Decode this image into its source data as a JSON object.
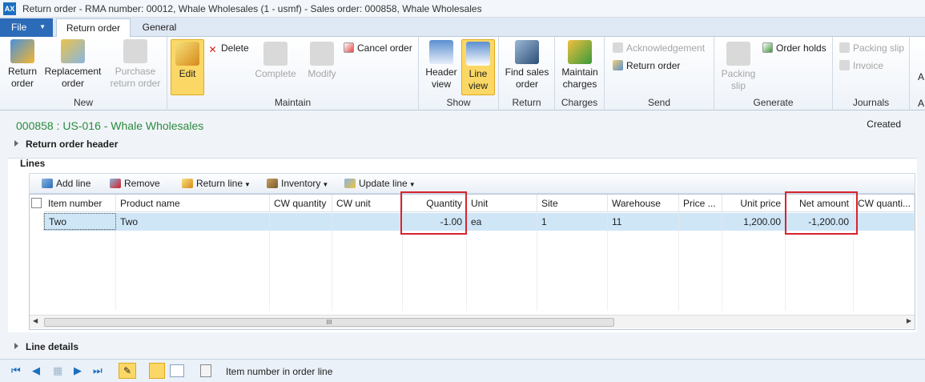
{
  "window": {
    "title": "Return order  -  RMA number: 00012,  Whale Wholesales (1 - usmf) - Sales order: 000858, Whale Wholesales",
    "icon": "app-icon"
  },
  "tabs": {
    "file": "File",
    "return_order": "Return order",
    "general": "General"
  },
  "ribbon": {
    "new": {
      "label": "New",
      "return_order": "Return order",
      "replacement_order": "Replacement order",
      "purchase_return_order": "Purchase return order"
    },
    "maintain": {
      "label": "Maintain",
      "edit": "Edit",
      "complete": "Complete",
      "modify": "Modify",
      "delete": "Delete",
      "cancel_order": "Cancel order"
    },
    "show": {
      "label": "Show",
      "header_view": "Header view",
      "line_view": "Line view"
    },
    "return": {
      "label": "Return",
      "find_sales_order": "Find sales order"
    },
    "charges": {
      "label": "Charges",
      "maintain_charges": "Maintain charges"
    },
    "send": {
      "label": "Send",
      "acknowledgement": "Acknowledgement",
      "return_order": "Return order"
    },
    "generate": {
      "label": "Generate",
      "packing_slip": "Packing slip",
      "order_holds": "Order holds"
    },
    "journals": {
      "label": "Journals",
      "packing_slip": "Packing slip",
      "invoice": "Invoice"
    },
    "extra": {
      "label1": "A",
      "label2": "A"
    }
  },
  "header": {
    "order_title": "000858 : US-016 - Whale Wholesales",
    "status": "Created",
    "return_order_header": "Return order header"
  },
  "lines": {
    "title": "Lines",
    "toolbar": {
      "add_line": "Add line",
      "remove": "Remove",
      "return_line": "Return line",
      "inventory": "Inventory",
      "update_line": "Update line"
    },
    "columns": [
      "Item number",
      "Product name",
      "CW quantity",
      "CW unit",
      "Quantity",
      "Unit",
      "Site",
      "Warehouse",
      "Price ...",
      "Unit price",
      "Net amount",
      "CW quanti..."
    ],
    "rows": [
      {
        "item_number": "Two",
        "product_name": "Two",
        "cw_quantity": "",
        "cw_unit": "",
        "quantity": "-1.00",
        "unit": "ea",
        "site": "1",
        "warehouse": "11",
        "price": "",
        "unit_price": "1,200.00",
        "net_amount": "-1,200.00",
        "cw_quantity2": ""
      }
    ],
    "scroll_thumb": "III"
  },
  "line_details": "Line details",
  "status_bar": {
    "text": "Item number in order line"
  }
}
